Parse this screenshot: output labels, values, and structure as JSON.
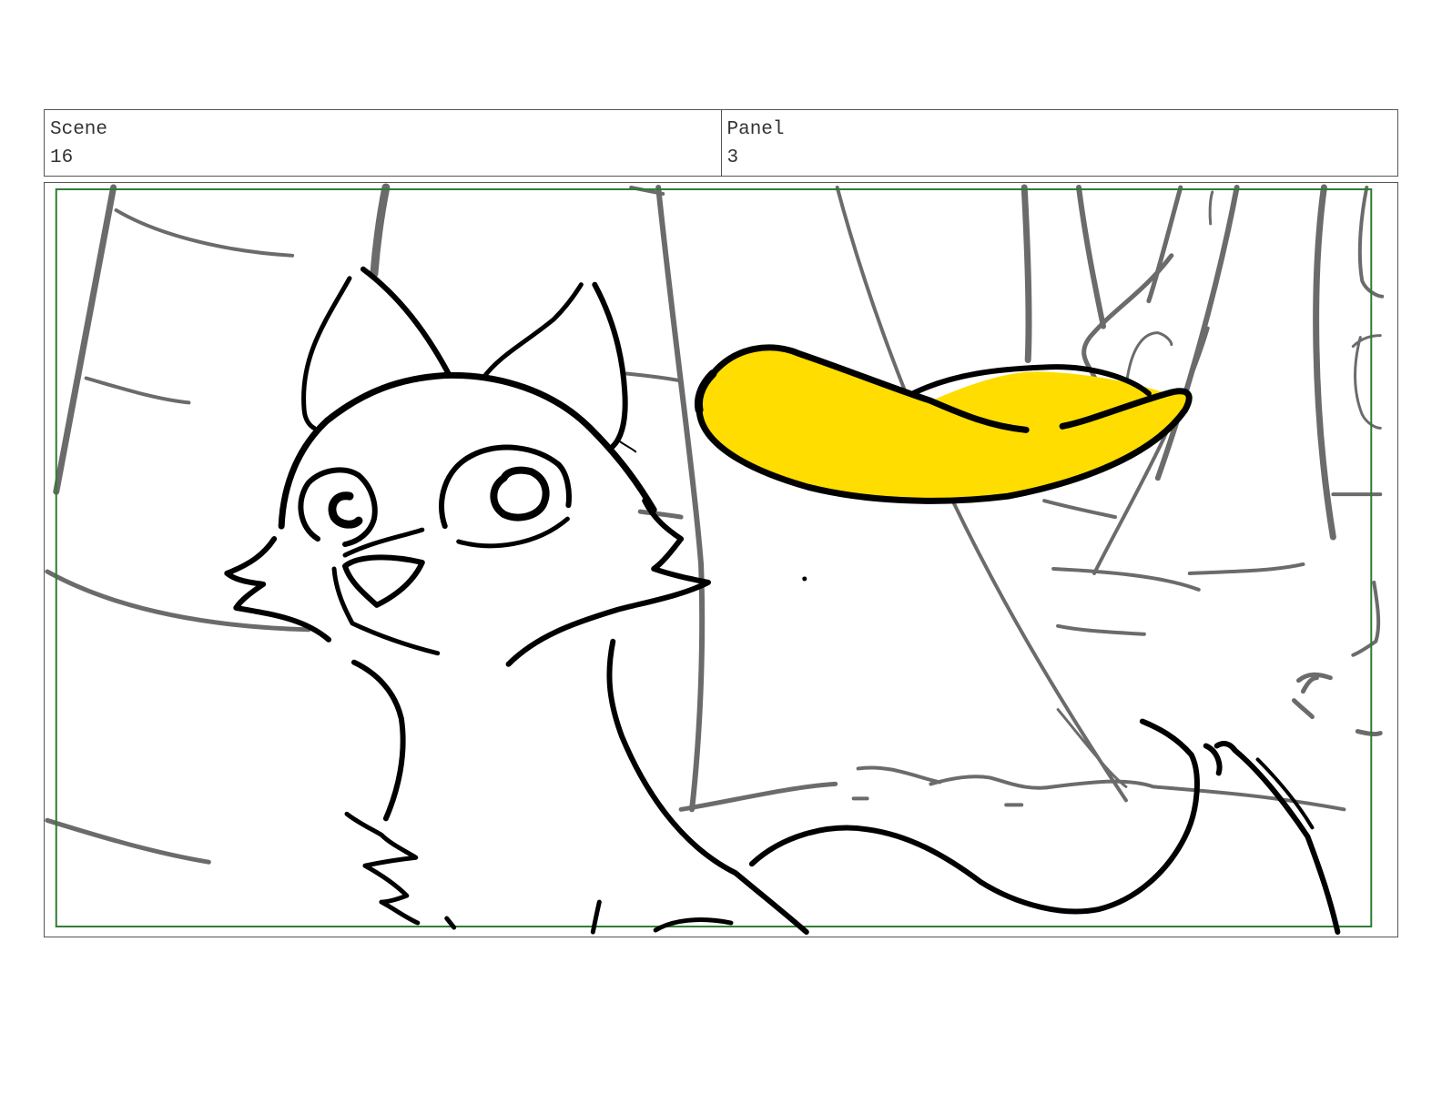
{
  "header": {
    "scene_label": "Scene",
    "scene_value": "16",
    "panel_label": "Panel",
    "panel_value": "3"
  },
  "colors": {
    "frame_border": "#555555",
    "safe_area": "#2e7d32",
    "background_lines": "#666666",
    "ink": "#000000",
    "leaf_fill": "#ffdd00"
  }
}
